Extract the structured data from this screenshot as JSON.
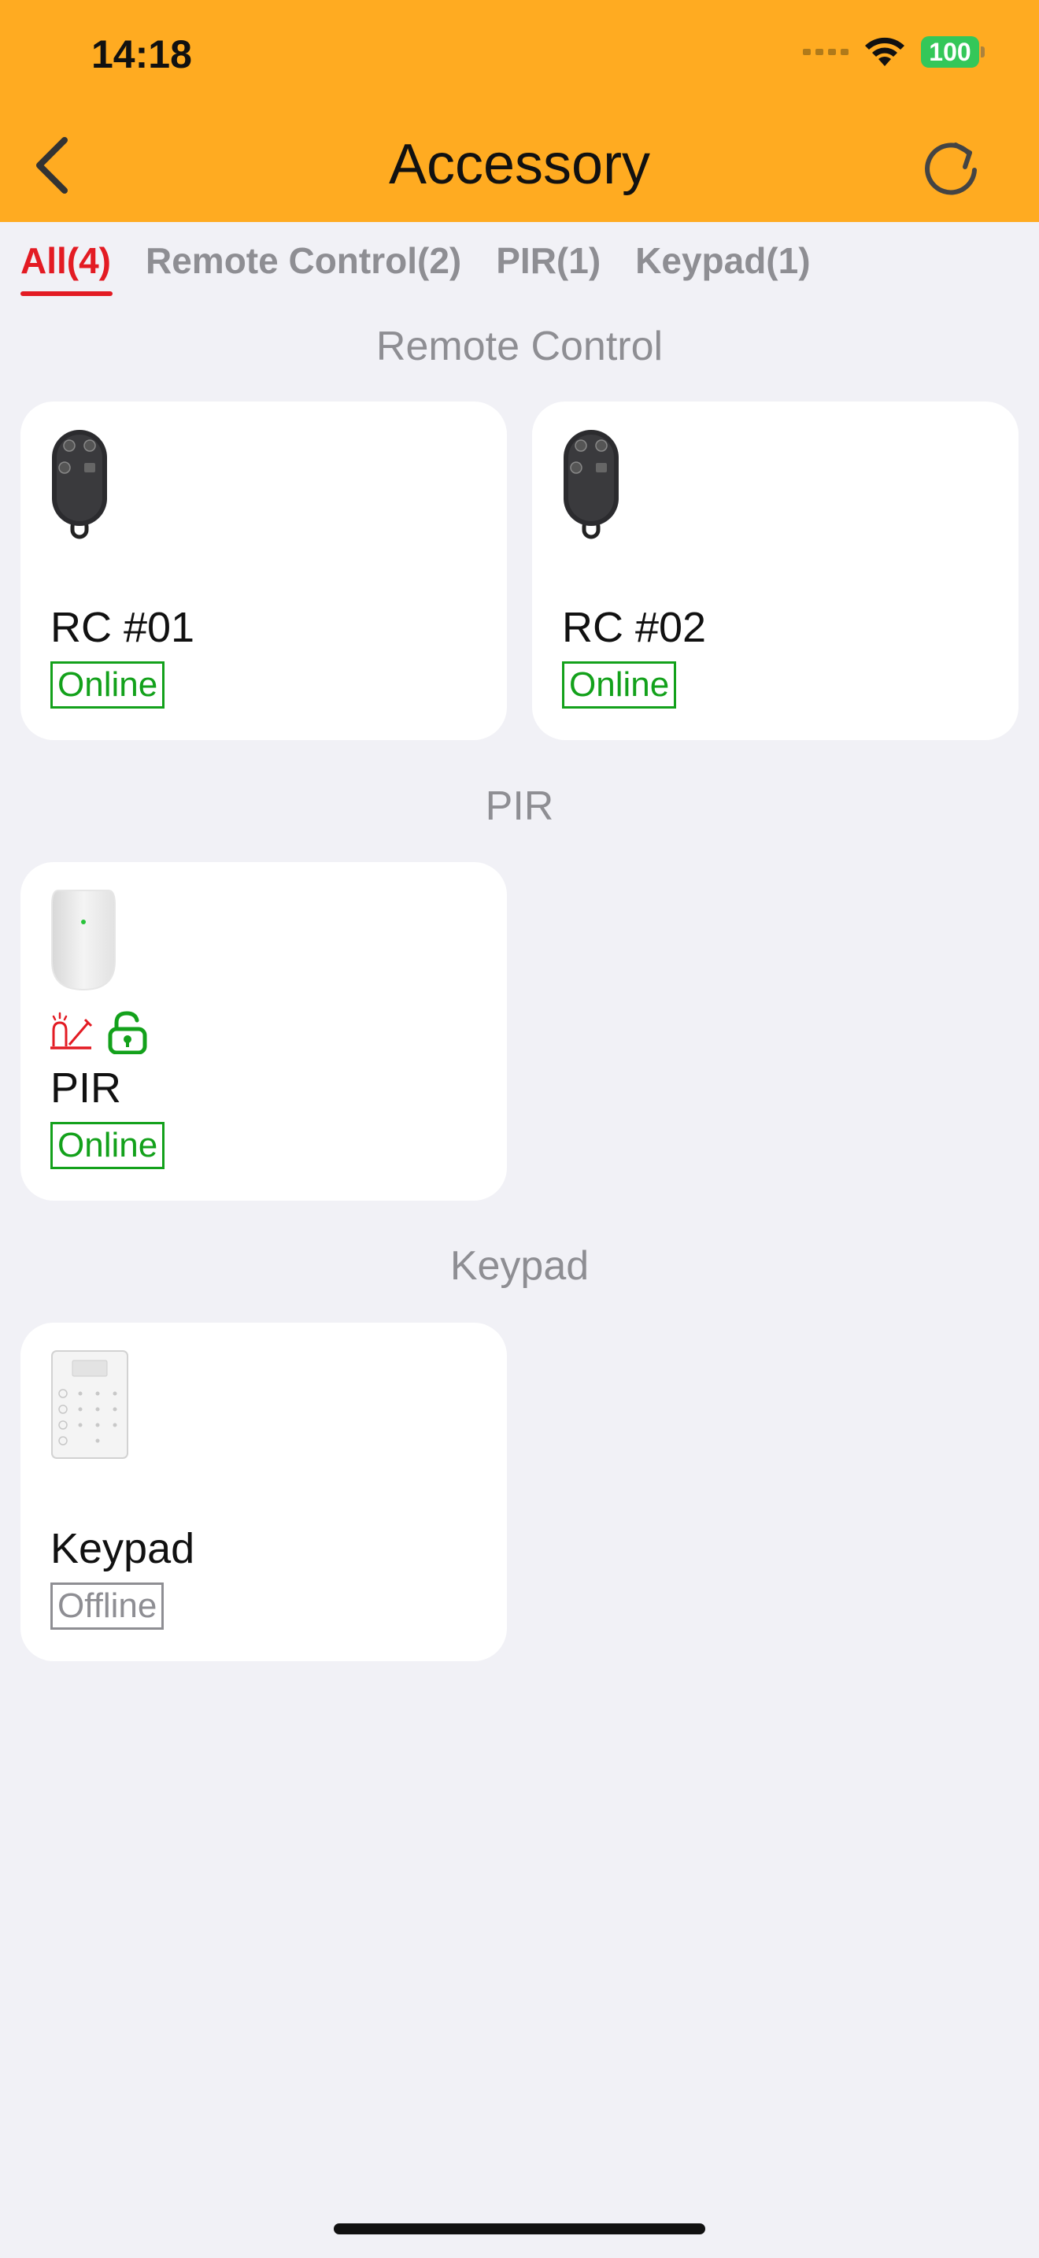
{
  "status_bar": {
    "time": "14:18",
    "battery": "100"
  },
  "header": {
    "title": "Accessory"
  },
  "tabs": [
    {
      "label": "All(4)",
      "active": true
    },
    {
      "label": "Remote Control(2)",
      "active": false
    },
    {
      "label": "PIR(1)",
      "active": false
    },
    {
      "label": "Keypad(1)",
      "active": false
    }
  ],
  "sections": {
    "remote": {
      "title": "Remote Control"
    },
    "pir": {
      "title": "PIR"
    },
    "keypad": {
      "title": "Keypad"
    }
  },
  "devices": [
    {
      "name": "RC #01",
      "status": "Online",
      "icon": "remote-control-icon"
    },
    {
      "name": "RC #02",
      "status": "Online",
      "icon": "remote-control-icon"
    },
    {
      "name": "PIR",
      "status": "Online",
      "icon": "pir-sensor-icon"
    },
    {
      "name": "Keypad",
      "status": "Offline",
      "icon": "keypad-icon"
    }
  ],
  "colors": {
    "header": "#ffab21",
    "active_tab": "#e31b23",
    "online": "#13a11b",
    "offline": "#8e8e93"
  }
}
